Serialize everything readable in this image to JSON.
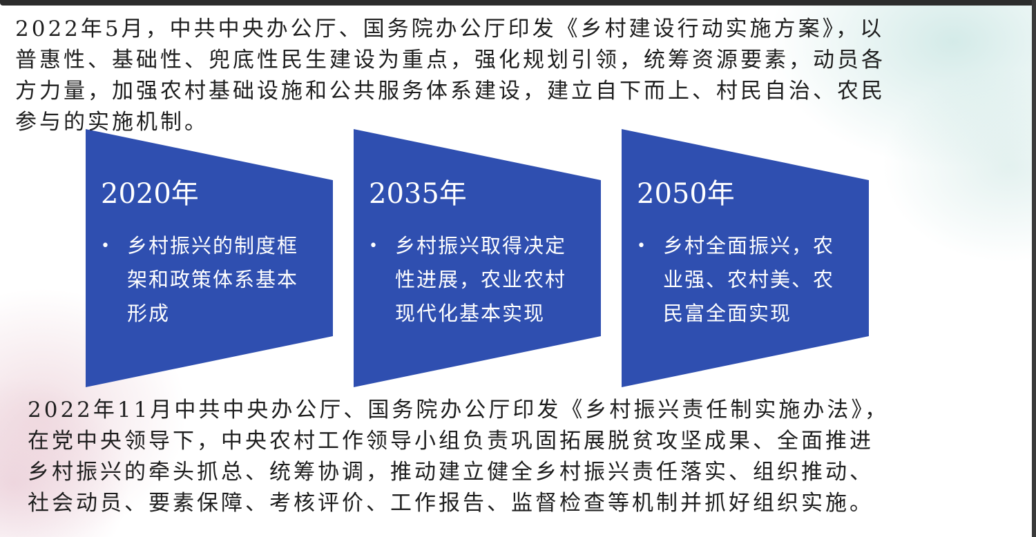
{
  "top_paragraph": {
    "lines": [
      "2022年5月，中共中央办公厅、国务院办公厅印发《乡村建设行动实施方案》，以",
      "普惠性、基础性、兜底性民生建设为重点，强化规划引领，统筹资源要素，动员各",
      "方力量，加强农村基础设施和公共服务体系建设，建立自下而上、村民自治、农民",
      "参与的实施机制。"
    ]
  },
  "milestones": [
    {
      "year": "2020年",
      "description": "乡村振兴的制度框架和政策体系基本形成"
    },
    {
      "year": "2035年",
      "description": "乡村振兴取得决定性进展，农业农村现代化基本实现"
    },
    {
      "year": "2050年",
      "description": "乡村全面振兴，农业强、农村美、农民富全面实现"
    }
  ],
  "bottom_paragraph": {
    "lines": [
      "2022年11月中共中央办公厅、国务院办公厅印发《乡村振兴责任制实施办法》，",
      "在党中央领导下，中央农村工作领导小组负责巩固拓展脱贫攻坚成果、全面推进",
      "乡村振兴的牵头抓总、统筹协调，推动建立健全乡村振兴责任落实、组织推动、",
      "社会动员、要素保障、考核评价、工作报告、监督检查等机制并抓好组织实施。"
    ]
  },
  "colors": {
    "card_fill": "#2f4fb0",
    "text": "#1e1e1e",
    "card_text": "#ffffff"
  }
}
